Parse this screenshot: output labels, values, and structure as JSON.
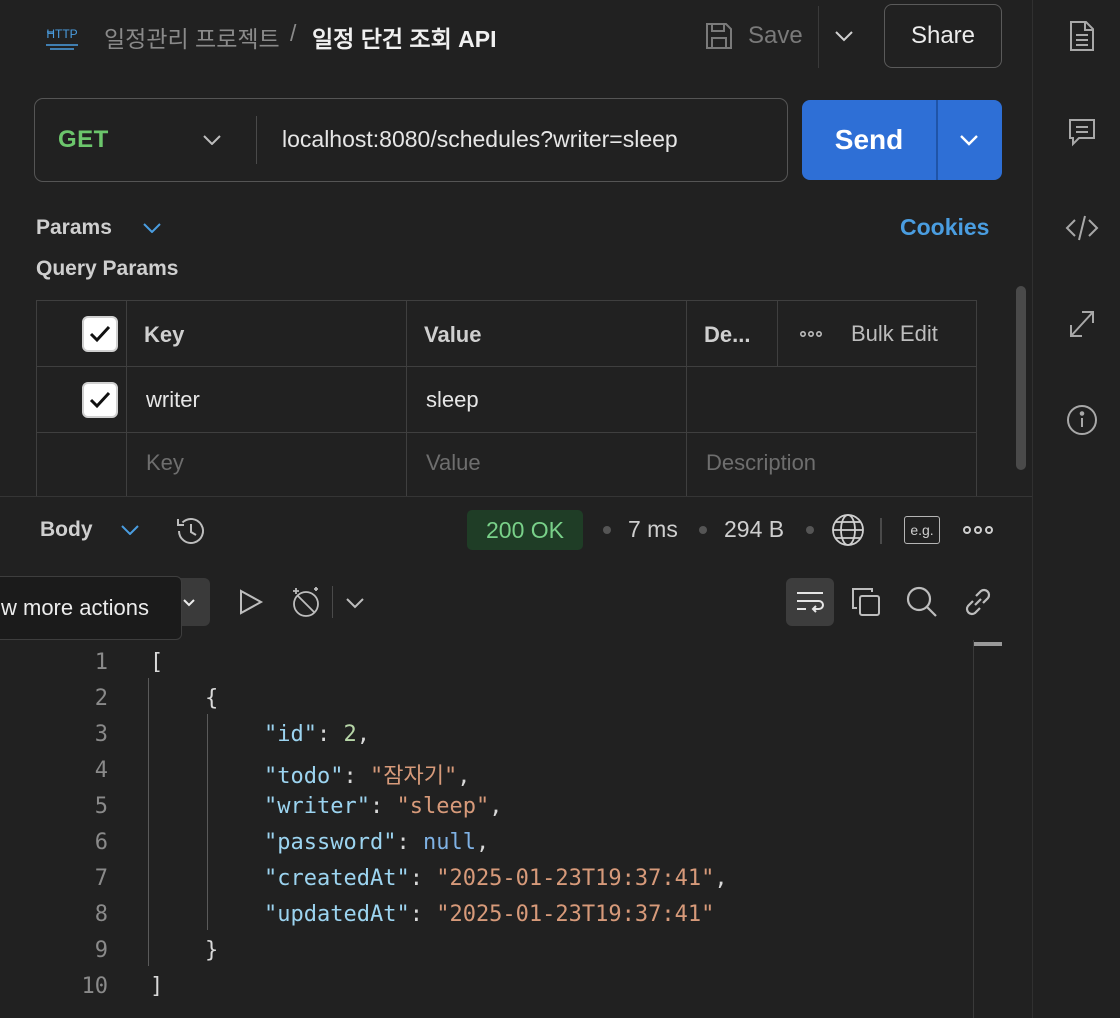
{
  "header": {
    "http_badge": "HTTP",
    "collection": "일정관리 프로젝트",
    "separator": "/",
    "request_title": "일정 단건 조회 API",
    "save_label": "Save",
    "share_label": "Share"
  },
  "request": {
    "method": "GET",
    "url": "localhost:8080/schedules?writer=sleep",
    "send_label": "Send"
  },
  "params": {
    "tab_label": "Params",
    "cookies_label": "Cookies",
    "section_title": "Query Params",
    "headers": {
      "key": "Key",
      "value": "Value",
      "description": "De...",
      "bulk_edit": "Bulk Edit"
    },
    "rows": [
      {
        "checked": true,
        "key": "writer",
        "value": "sleep",
        "description": ""
      }
    ],
    "placeholders": {
      "key": "Key",
      "value": "Value",
      "description": "Description"
    }
  },
  "response": {
    "body_label": "Body",
    "status": "200 OK",
    "time": "7 ms",
    "size": "294 B",
    "example_badge": "e.g.",
    "tooltip": "w more actions"
  },
  "code": {
    "line_numbers": [
      "1",
      "2",
      "3",
      "4",
      "5",
      "6",
      "7",
      "8",
      "9",
      "10"
    ],
    "open_bracket": "[",
    "open_brace": "{",
    "fields": [
      {
        "key": "\"id\"",
        "value": "2",
        "value_type": "number",
        "trail": ","
      },
      {
        "key": "\"todo\"",
        "value": "\"잠자기\"",
        "value_type": "string",
        "trail": ","
      },
      {
        "key": "\"writer\"",
        "value": "\"sleep\"",
        "value_type": "string",
        "trail": ","
      },
      {
        "key": "\"password\"",
        "value": "null",
        "value_type": "null",
        "trail": ","
      },
      {
        "key": "\"createdAt\"",
        "value": "\"2025-01-23T19:37:41\"",
        "value_type": "string",
        "trail": ","
      },
      {
        "key": "\"updatedAt\"",
        "value": "\"2025-01-23T19:37:41\"",
        "value_type": "string",
        "trail": ""
      }
    ],
    "close_brace": "}",
    "close_bracket": "]"
  },
  "icons": {
    "sidebar": [
      "docs-icon",
      "comments-icon",
      "code-icon",
      "related-requests-icon",
      "info-icon"
    ],
    "accent": "#2e6fd6",
    "link": "#4a9de0",
    "method_color": "#6cc66c",
    "status_color": "#79d189"
  }
}
